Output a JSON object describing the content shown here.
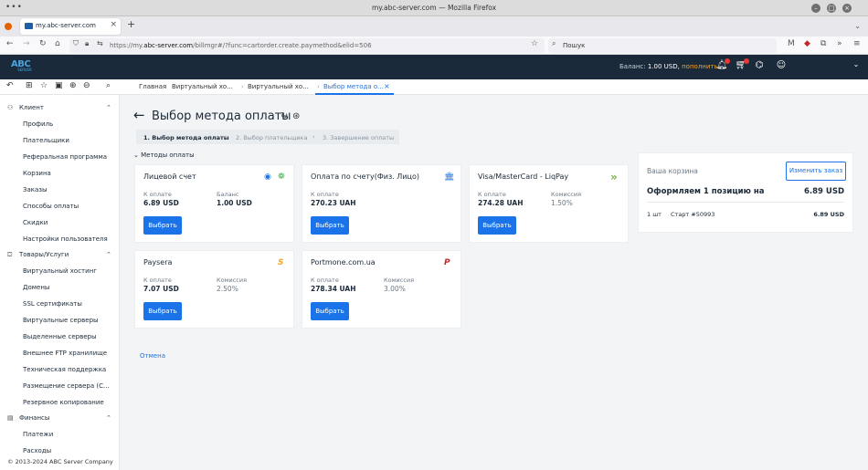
{
  "browser": {
    "window_title": "my.abc-server.com — Mozilla Firefox",
    "tab_title": "my.abc-server.com",
    "url_prefix": "https://my.",
    "url_domain": "abc-server.com",
    "url_rest": "/billmgr#/?func=cartorder.create.paymethod&elid=506",
    "search_placeholder": "Пошук"
  },
  "header": {
    "logo_text": "ABC",
    "logo_sub": "SERVER",
    "balance_label": "Баланс:",
    "balance_amount": "1.00 USD,",
    "topup": "пополнить"
  },
  "breadcrumbs": [
    "Главная",
    "Виртуальный хо...",
    "Виртуальный хо...",
    "Выбор метода о..."
  ],
  "sidebar": {
    "groups": [
      {
        "label": "Клиент",
        "items": [
          "Профиль",
          "Плательщики",
          "Реферальная программа",
          "Корзина",
          "Заказы",
          "Способы оплаты",
          "Скидки",
          "Настройки пользователя"
        ]
      },
      {
        "label": "Товары/Услуги",
        "items": [
          "Виртуальный хостинг",
          "Домены",
          "SSL сертификаты",
          "Виртуальные серверы",
          "Выделенные серверы",
          "Внешнее FTP хранилище",
          "Техническая поддержка",
          "Размещение сервера (С...",
          "Резервное копирование"
        ]
      },
      {
        "label": "Финансы",
        "items": [
          "Платежи",
          "Расходы"
        ]
      }
    ],
    "copyright": "© 2013-2024 ABC Server Company"
  },
  "page": {
    "title": "Выбор метода оплаты",
    "steps": [
      "1. Выбор метода оплаты",
      "2. Выбор плательщика",
      "3. Завершение оплаты"
    ],
    "methods_label": "Методы оплаты",
    "cancel": "Отмена"
  },
  "cards": [
    {
      "title": "Лицевой счет",
      "label1": "К оплате",
      "value1": "6.89 USD",
      "label2": "Баланс",
      "value2": "1.00 USD",
      "button": "Выбрать"
    },
    {
      "title": "Оплата по счету(Физ. Лицо)",
      "label1": "К оплате",
      "value1": "270.23 UAH",
      "button": "Выбрать"
    },
    {
      "title": "Visa/MasterCard - LiqPay",
      "label1": "К оплате",
      "value1": "274.28 UAH",
      "label2": "Комиссия",
      "value2": "1.50%",
      "button": "Выбрать"
    },
    {
      "title": "Paysera",
      "label1": "К оплате",
      "value1": "7.07 USD",
      "label2": "Комиссия",
      "value2": "2.50%",
      "button": "Выбрать"
    },
    {
      "title": "Portmone.com.ua",
      "label1": "К оплате",
      "value1": "278.34 UAH",
      "label2": "Комиссия",
      "value2": "3.00%",
      "button": "Выбрать"
    }
  ],
  "cart": {
    "heading": "Ваша корзина",
    "edit_button": "Изменить заказ",
    "summary": "Оформляем 1 позицию на",
    "total": "6.89 USD",
    "item_qty": "1 шт",
    "item_name": "Старт #50993",
    "item_price": "6.89 USD"
  },
  "colors": {
    "accent": "#1a73e8",
    "header_bg": "#1b2a3a",
    "topup": "#f5a623"
  }
}
